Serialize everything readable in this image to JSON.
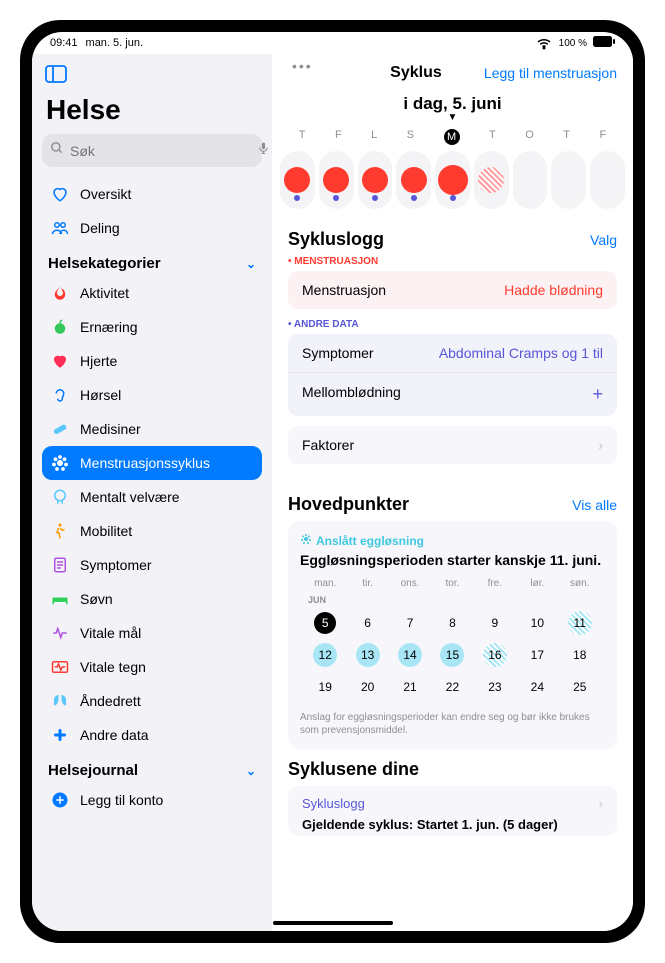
{
  "status": {
    "time": "09:41",
    "date": "man. 5. jun.",
    "battery": "100 %",
    "wifi": "􀙇"
  },
  "sidebar": {
    "title": "Helse",
    "search_placeholder": "Søk",
    "nav_primary": [
      {
        "label": "Oversikt",
        "icon_color": "#007aff"
      },
      {
        "label": "Deling",
        "icon_color": "#007aff"
      }
    ],
    "categories_header": "Helsekategorier",
    "categories": [
      {
        "label": "Aktivitet"
      },
      {
        "label": "Ernæring"
      },
      {
        "label": "Hjerte"
      },
      {
        "label": "Hørsel"
      },
      {
        "label": "Medisiner"
      },
      {
        "label": "Menstruasjonssyklus"
      },
      {
        "label": "Mentalt velvære"
      },
      {
        "label": "Mobilitet"
      },
      {
        "label": "Symptomer"
      },
      {
        "label": "Søvn"
      },
      {
        "label": "Vitale mål"
      },
      {
        "label": "Vitale tegn"
      },
      {
        "label": "Åndedrett"
      },
      {
        "label": "Andre data"
      }
    ],
    "journal_header": "Helsejournal",
    "journal": [
      {
        "label": "Legg til konto"
      }
    ]
  },
  "main": {
    "header_center": "Syklus",
    "header_right": "Legg til menstruasjon",
    "date_title": "i dag, 5. juni",
    "week_letters": [
      "T",
      "F",
      "L",
      "S",
      "M",
      "T",
      "O",
      "T",
      "F"
    ],
    "today_idx": 4,
    "cycle_days": [
      {
        "red": true,
        "purple": true
      },
      {
        "red": true,
        "purple": true
      },
      {
        "red": true,
        "purple": true
      },
      {
        "red": true,
        "purple": true
      },
      {
        "red": true,
        "big": true,
        "purple": true
      },
      {
        "hatch": true
      },
      {},
      {},
      {}
    ],
    "log": {
      "title": "Sykluslogg",
      "action": "Valg",
      "menstruation_label": "MENSTRUASJON",
      "menstruation_row": {
        "label": "Menstruasjon",
        "value": "Hadde blødning"
      },
      "other_label": "ANDRE DATA",
      "symptoms_row": {
        "label": "Symptomer",
        "value": "Abdominal Cramps og 1 til"
      },
      "spotting_row": {
        "label": "Mellomblødning"
      },
      "factors_row": {
        "label": "Faktorer"
      }
    },
    "highlights": {
      "title": "Hovedpunkter",
      "action": "Vis alle",
      "tag": "Anslått eggløsning",
      "headline": "Eggløsningsperioden starter kanskje 11. juni.",
      "weekdays": [
        "man.",
        "tir.",
        "ons.",
        "tor.",
        "fre.",
        "lør.",
        "søn."
      ],
      "month": "JUN",
      "rows": [
        [
          5,
          6,
          7,
          8,
          9,
          10,
          11
        ],
        [
          12,
          13,
          14,
          15,
          16,
          17,
          18
        ],
        [
          19,
          20,
          21,
          22,
          23,
          24,
          25
        ]
      ],
      "today": 5,
      "fertile_edge": [
        11,
        16
      ],
      "fertile": [
        12,
        13,
        14,
        15
      ],
      "note": "Anslag for eggløsningsperioder kan endre seg og bør ikke brukes som prevensjonsmiddel."
    },
    "your_cycles": {
      "title": "Syklusene dine",
      "link": "Sykluslogg",
      "sub": "Gjeldende syklus: Startet 1. jun. (5 dager)"
    }
  }
}
